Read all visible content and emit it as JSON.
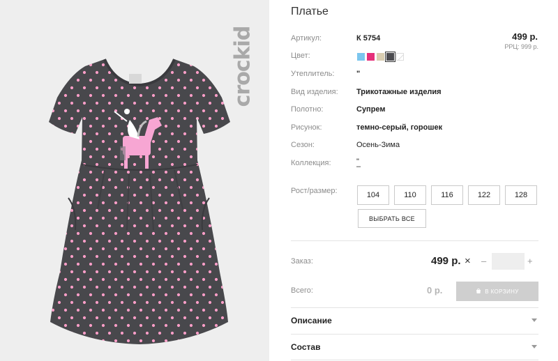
{
  "product": {
    "title": "Платье",
    "brand": "crockid",
    "price": "499 р.",
    "rrp": "РРЦ: 999 р."
  },
  "attributes": {
    "article": {
      "label": "Артикул:",
      "value": "К 5754"
    },
    "color": {
      "label": "Цвет:"
    },
    "insulation": {
      "label": "Утеплитель:",
      "value": "\""
    },
    "type": {
      "label": "Вид изделия:",
      "value": "Трикотажные изделия"
    },
    "fabric": {
      "label": "Полотно:",
      "value": "Супрем"
    },
    "pattern": {
      "label": "Рисунок:",
      "value": "темно-серый, горошек"
    },
    "season": {
      "label": "Сезон:",
      "value": "Осень-Зима"
    },
    "collection": {
      "label": "Коллекция:",
      "value": "\"",
      "value2": "–"
    }
  },
  "colors": [
    "#7cc6ee",
    "#e5307a",
    "#d9cdb1",
    "#4b4b4f",
    "#ffffff"
  ],
  "selected_color_index": 3,
  "sizes": {
    "label": "Рост/размер:",
    "options": [
      "104",
      "110",
      "116",
      "122",
      "128"
    ],
    "select_all": "ВЫБРАТЬ ВСЕ"
  },
  "order": {
    "label": "Заказ:",
    "price": "499 р.",
    "times": "×",
    "minus": "–",
    "plus": "+",
    "quantity": ""
  },
  "total": {
    "label": "Всего:",
    "value": "0 р.",
    "cart_button": "В КОРЗИНУ"
  },
  "accordions": {
    "description": "Описание",
    "composition": "Состав"
  },
  "theme": {
    "image_bg": "#eeeeee",
    "dress": "#48484c",
    "dots": "#ff9ec8",
    "disabled_button": "#cfcfcf"
  }
}
